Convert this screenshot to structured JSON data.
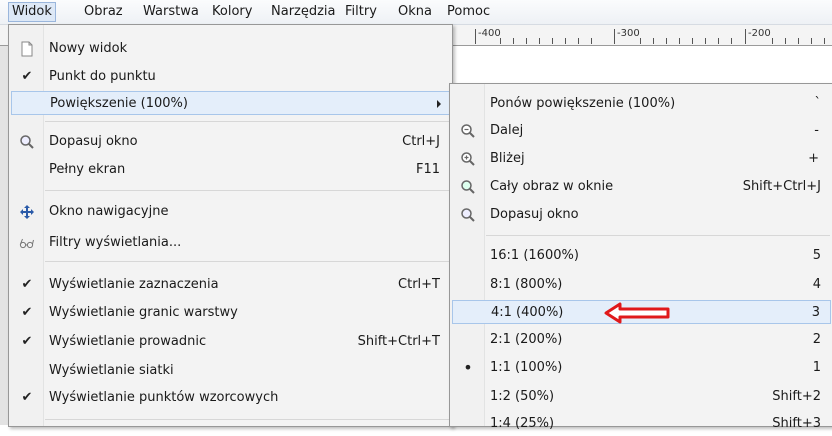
{
  "menubar": {
    "items": [
      "Widok",
      "Obraz",
      "Warstwa",
      "Kolory",
      "Narzędzia",
      "Filtry",
      "Okna",
      "Pomoc"
    ]
  },
  "ruler": {
    "labels": [
      "-400",
      "-300",
      "-200"
    ]
  },
  "view_menu": {
    "new_view": "Nowy widok",
    "dot_for_dot": "Punkt do punktu",
    "zoom": "Powiększenie (100%)",
    "shrink_wrap": "Dopasuj okno",
    "shrink_wrap_sc": "Ctrl+J",
    "fullscreen": "Pełny ekran",
    "fullscreen_sc": "F11",
    "navigation": "Okno nawigacyjne",
    "display_filters": "Filtry wyświetlania...",
    "show_selection": "Wyświetlanie zaznaczenia",
    "show_selection_sc": "Ctrl+T",
    "show_layer_boundary": "Wyświetlanie granic warstwy",
    "show_guides": "Wyświetlanie prowadnic",
    "show_guides_sc": "Shift+Ctrl+T",
    "show_grid": "Wyświetlanie siatki",
    "show_sample_points": "Wyświetlanie punktów wzorcowych"
  },
  "zoom_menu": {
    "revert": "Ponów powiększenie (100%)",
    "revert_sc": "`",
    "zoom_out": "Dalej",
    "zoom_out_sc": "-",
    "zoom_in": "Bliżej",
    "zoom_in_sc": "+",
    "fit_image": "Cały obraz w oknie",
    "fit_image_sc": "Shift+Ctrl+J",
    "fit_window": "Dopasuj okno",
    "ratios": [
      {
        "label": "16:1  (1600%)",
        "sc": "5"
      },
      {
        "label": "8:1  (800%)",
        "sc": "4"
      },
      {
        "label": "4:1  (400%)",
        "sc": "3"
      },
      {
        "label": "2:1  (200%)",
        "sc": "2"
      },
      {
        "label": "1:1  (100%)",
        "sc": "1"
      },
      {
        "label": "1:2  (50%)",
        "sc": "Shift+2"
      },
      {
        "label": "1:4  (25%)",
        "sc": "Shift+3"
      }
    ]
  },
  "annotation": {
    "arrow_color": "#e0191b"
  }
}
